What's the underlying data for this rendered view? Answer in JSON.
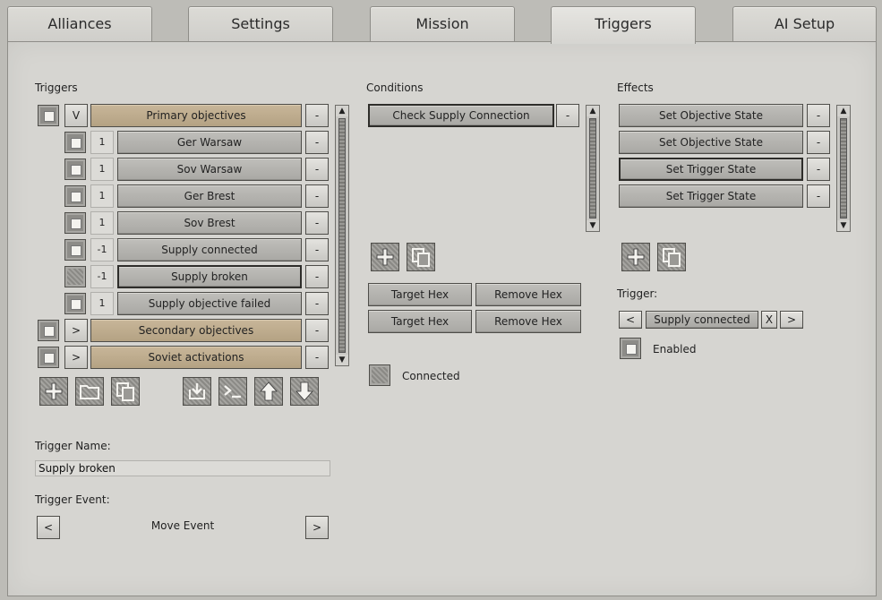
{
  "tabs": [
    {
      "label": "Alliances"
    },
    {
      "label": "Settings"
    },
    {
      "label": "Mission"
    },
    {
      "label": "Triggers",
      "active": true
    },
    {
      "label": "AI Setup"
    }
  ],
  "triggers": {
    "heading": "Triggers",
    "groups": [
      {
        "toggle": "V",
        "label": "Primary objectives",
        "remove": "-"
      },
      {
        "toggle": ">",
        "label": "Secondary objectives",
        "remove": "-"
      },
      {
        "toggle": ">",
        "label": "Soviet activations",
        "remove": "-"
      }
    ],
    "items": [
      {
        "count": "1",
        "label": "Ger Warsaw",
        "remove": "-"
      },
      {
        "count": "1",
        "label": "Sov Warsaw",
        "remove": "-"
      },
      {
        "count": "1",
        "label": "Ger Brest",
        "remove": "-"
      },
      {
        "count": "1",
        "label": "Sov Brest",
        "remove": "-"
      },
      {
        "count": "-1",
        "label": "Supply connected",
        "remove": "-"
      },
      {
        "count": "-1",
        "label": "Supply broken",
        "remove": "-"
      },
      {
        "count": "1",
        "label": "Supply objective failed",
        "remove": "-"
      }
    ],
    "tool_icons": [
      "add-icon",
      "folder-icon",
      "copy-icon",
      "import-icon",
      "console-icon",
      "move-up-icon",
      "move-down-icon"
    ],
    "name_label": "Trigger Name:",
    "name_value": "Supply broken",
    "event_label": "Trigger Event:",
    "event_prev": "<",
    "event_value": "Move Event",
    "event_next": ">"
  },
  "conditions": {
    "heading": "Conditions",
    "items": [
      {
        "label": "Check Supply Connection",
        "remove": "-"
      }
    ],
    "tool_icons": [
      "add-icon",
      "copy-icon"
    ],
    "hex_buttons": [
      {
        "target": "Target Hex",
        "remove": "Remove Hex"
      },
      {
        "target": "Target Hex",
        "remove": "Remove Hex"
      }
    ],
    "connected_label": "Connected"
  },
  "effects": {
    "heading": "Effects",
    "items": [
      {
        "label": "Set Objective State",
        "remove": "-"
      },
      {
        "label": "Set Objective State",
        "remove": "-"
      },
      {
        "label": "Set Trigger State",
        "remove": "-"
      },
      {
        "label": "Set Trigger State",
        "remove": "-"
      }
    ],
    "tool_icons": [
      "add-icon",
      "copy-icon"
    ],
    "trigger_label": "Trigger:",
    "trigger_prev": "<",
    "trigger_value": "Supply connected",
    "trigger_clear": "X",
    "trigger_next": ">",
    "enabled_label": "Enabled"
  },
  "colors": {
    "panel": "#d6d5d1",
    "group_tan": "#c1ae8f",
    "border_dark": "#4e4d49"
  }
}
